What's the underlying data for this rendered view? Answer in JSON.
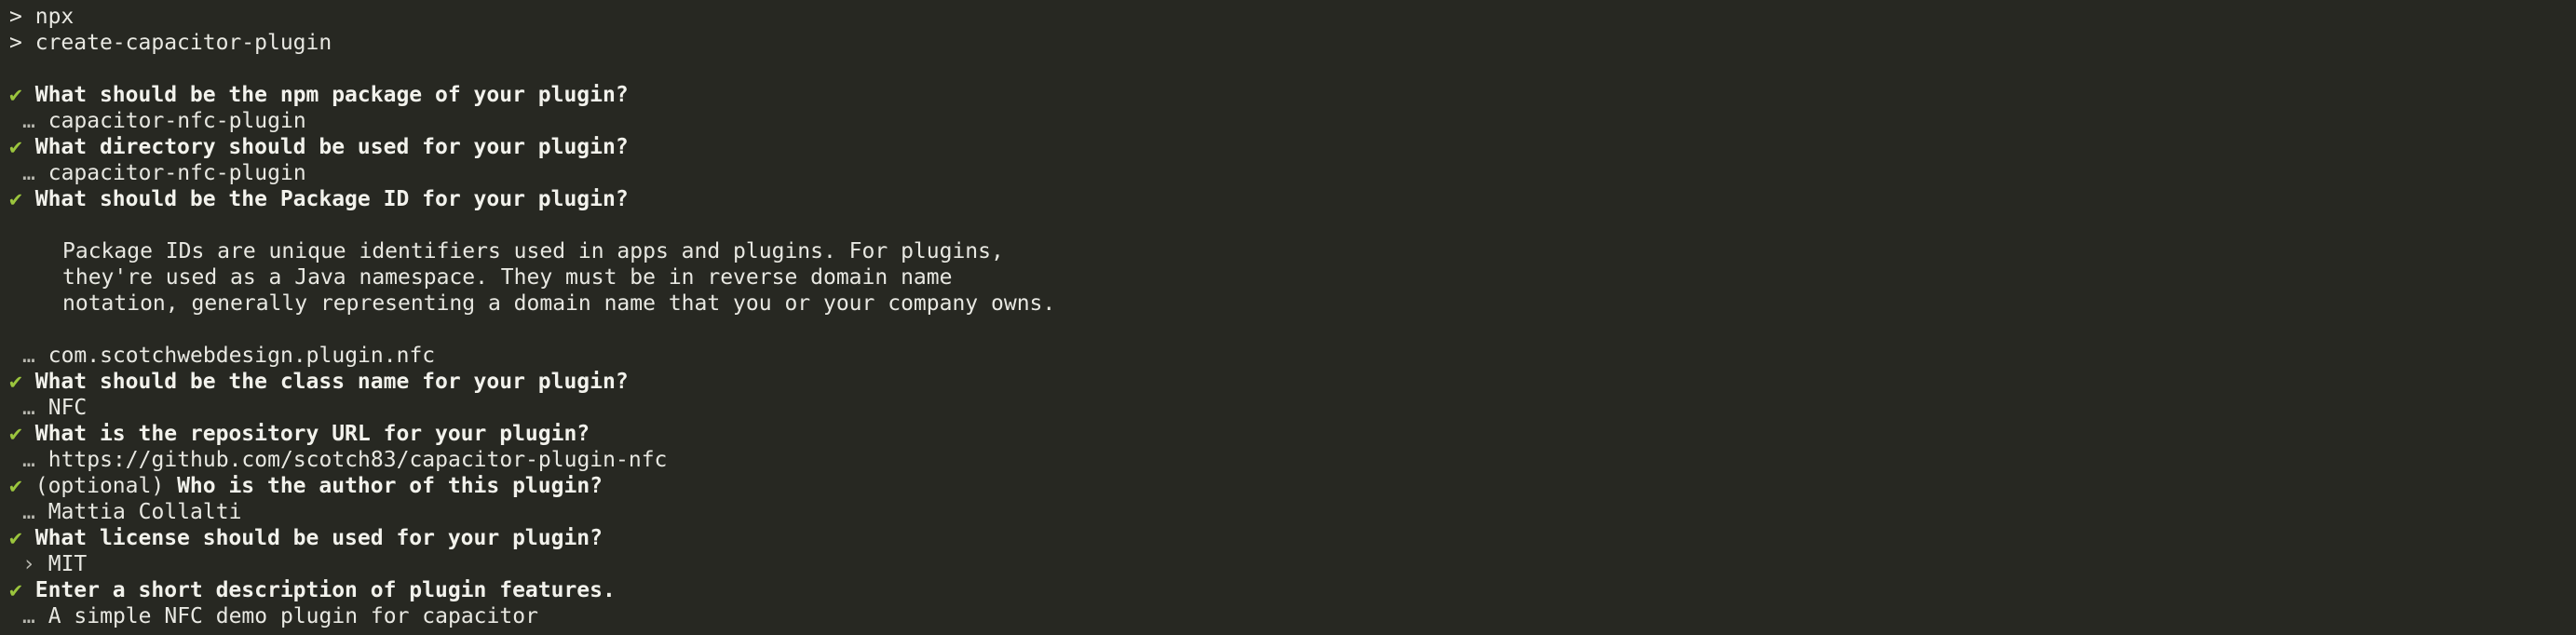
{
  "prompt_symbol": ">",
  "check_mark": "✔",
  "answer_marker": "…",
  "select_marker": "›",
  "commands": [
    "npx",
    "create-capacitor-plugin"
  ],
  "q1": {
    "question": "What should be the npm package of your plugin?",
    "answer": "capacitor-nfc-plugin"
  },
  "q2": {
    "question": "What directory should be used for your plugin?",
    "answer": "capacitor-nfc-plugin"
  },
  "q3": {
    "question": "What should be the Package ID for your plugin?",
    "help": [
      "Package IDs are unique identifiers used in apps and plugins. For plugins,",
      "they're used as a Java namespace. They must be in reverse domain name",
      "notation, generally representing a domain name that you or your company owns."
    ],
    "answer": "com.scotchwebdesign.plugin.nfc"
  },
  "q4": {
    "question": "What should be the class name for your plugin?",
    "answer": "NFC"
  },
  "q5": {
    "question": "What is the repository URL for your plugin?",
    "answer": "https://github.com/scotch83/capacitor-plugin-nfc"
  },
  "q6": {
    "prefix": "(optional)",
    "question": "Who is the author of this plugin?",
    "answer": "Mattia Collalti"
  },
  "q7": {
    "question": "What license should be used for your plugin?",
    "answer": "MIT"
  },
  "q8": {
    "question": "Enter a short description of plugin features.",
    "answer": "A simple NFC demo plugin for capacitor"
  }
}
